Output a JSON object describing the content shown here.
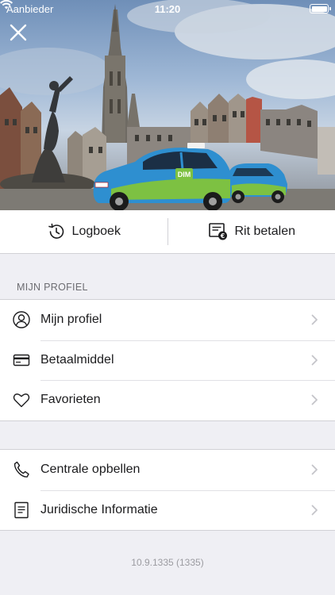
{
  "status_bar": {
    "carrier": "Aanbieder",
    "time": "11:20"
  },
  "actions": {
    "logbook_label": "Logboek",
    "pay_ride_label": "Rit betalen"
  },
  "profile_section": {
    "header": "MIJN PROFIEL",
    "items": [
      {
        "label": "Mijn profiel",
        "icon": "user-icon"
      },
      {
        "label": "Betaalmiddel",
        "icon": "credit-card-icon"
      },
      {
        "label": "Favorieten",
        "icon": "heart-icon"
      }
    ]
  },
  "support_section": {
    "items": [
      {
        "label": "Centrale opbellen",
        "icon": "phone-icon"
      },
      {
        "label": "Juridische Informatie",
        "icon": "document-icon"
      }
    ]
  },
  "taxi_logo_text": "DIM",
  "version": "10.9.1335 (1335)",
  "colors": {
    "taxi_blue": "#2e8fd0",
    "taxi_green": "#7dc142",
    "text": "#1c1c1e",
    "secondary_text": "#6d6d72",
    "background": "#efeff4"
  }
}
